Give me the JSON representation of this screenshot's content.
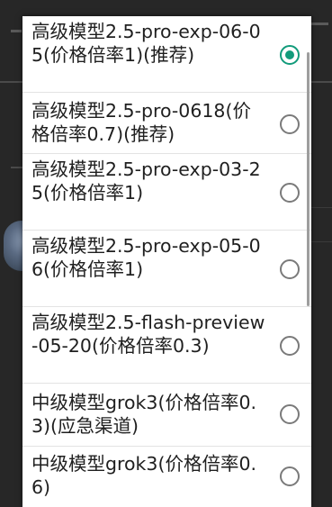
{
  "model_picker": {
    "accent_color": "#129b7b",
    "options": [
      {
        "label": "高级模型2.5-pro-exp-06-05(价格倍率1)(推荐)",
        "selected": true
      },
      {
        "label": "高级模型2.5-pro-0618(价格倍率0.7)(推荐)",
        "selected": false
      },
      {
        "label": "高级模型2.5-pro-exp-03-25(价格倍率1)",
        "selected": false
      },
      {
        "label": "高级模型2.5-pro-exp-05-06(价格倍率1)",
        "selected": false
      },
      {
        "label": "高级模型2.5-flash-preview-05-20(价格倍率0.3)",
        "selected": false
      },
      {
        "label": "中级模型grok3(价格倍率0.3)(应急渠道)",
        "selected": false
      },
      {
        "label": "中级模型grok3(价格倍率0.6)",
        "selected": false
      }
    ]
  }
}
